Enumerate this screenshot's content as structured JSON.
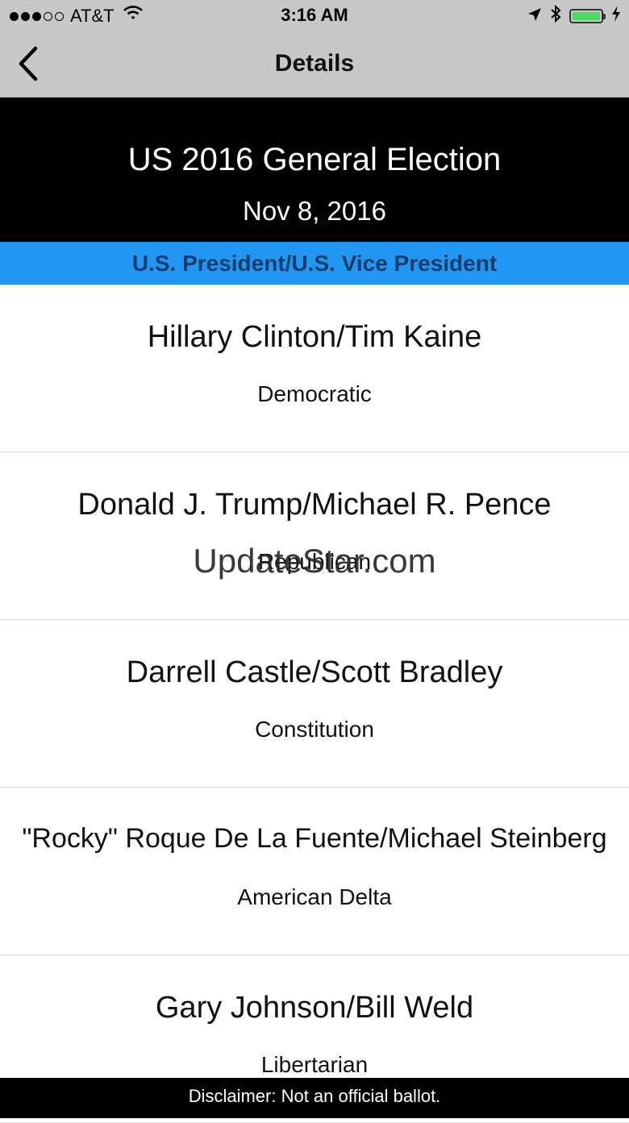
{
  "status_bar": {
    "carrier": "AT&T",
    "time": "3:16 AM",
    "signal_bars_filled": 3,
    "signal_bars_total": 5,
    "battery_level": 1.0
  },
  "nav": {
    "title": "Details",
    "back_icon": "chevron-left-icon"
  },
  "header": {
    "title": "US 2016 General Election",
    "date": "Nov 8, 2016"
  },
  "race": {
    "title": "U.S. President/U.S. Vice President"
  },
  "candidates": [
    {
      "name": "Hillary Clinton/Tim Kaine",
      "party": "Democratic"
    },
    {
      "name": "Donald J. Trump/Michael R. Pence",
      "party": "Republican"
    },
    {
      "name": "Darrell Castle/Scott Bradley",
      "party": "Constitution"
    },
    {
      "name": "\"Rocky\" Roque De La Fuente/Michael Steinberg",
      "party": "American Delta"
    },
    {
      "name": "Gary Johnson/Bill Weld",
      "party": "Libertarian"
    }
  ],
  "watermark": "UpdateStar.com",
  "footer": {
    "disclaimer": "Disclaimer: Not an official ballot."
  },
  "colors": {
    "race_bar": "#2196f3",
    "header_bg": "#000000",
    "nav_bg": "#c8c8c8",
    "battery": "#4cd964"
  }
}
